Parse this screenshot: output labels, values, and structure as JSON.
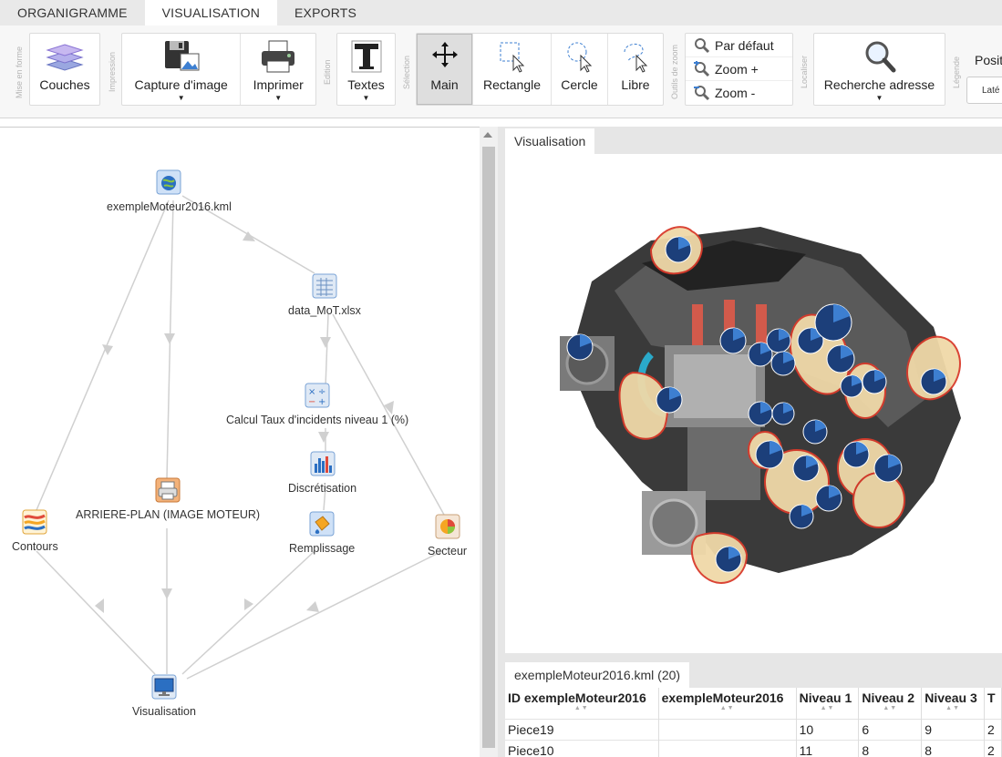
{
  "tabs": [
    {
      "label": "ORGANIGRAMME",
      "active": false
    },
    {
      "label": "VISUALISATION",
      "active": true
    },
    {
      "label": "EXPORTS",
      "active": false
    }
  ],
  "ribbon": {
    "groups": {
      "mise_en_forme": "Mise en forme",
      "impression": "Impression",
      "edition": "Edition",
      "selection": "Sélection",
      "outils_zoom": "Outils de zoom",
      "localiser": "Localiser",
      "legende": "Légende"
    },
    "couches": "Couches",
    "capture": "Capture d'image",
    "imprimer": "Imprimer",
    "textes": "Textes",
    "main": "Main",
    "rectangle": "Rectangle",
    "cercle": "Cercle",
    "libre": "Libre",
    "zoom_default": "Par défaut",
    "zoom_plus": "Zoom +",
    "zoom_minus": "Zoom -",
    "recherche": "Recherche adresse",
    "position_label": "Positi",
    "position_value": "Laté"
  },
  "graph": {
    "nodes": {
      "kml": "exempleMoteur2016.kml",
      "data": "data_MoT.xlsx",
      "calc": "Calcul Taux d'incidents niveau 1 (%)",
      "discr": "Discrétisation",
      "rempl": "Remplissage",
      "contours": "Contours",
      "arriere": "ARRIERE-PLAN (IMAGE MOTEUR)",
      "secteur": "Secteur",
      "visu": "Visualisation"
    }
  },
  "visualisation": {
    "tab": "Visualisation"
  },
  "table": {
    "tab": "exempleMoteur2016.kml (20)",
    "columns": [
      "ID exempleMoteur2016",
      "exempleMoteur2016",
      "Niveau 1",
      "Niveau 2",
      "Niveau 3",
      "T"
    ],
    "rows": [
      [
        "Piece19",
        "",
        "10",
        "6",
        "9",
        "2"
      ],
      [
        "Piece10",
        "",
        "11",
        "8",
        "8",
        "2"
      ]
    ]
  },
  "colors": {
    "accent": "#4a90d9",
    "pie_dark": "#1c3f7a",
    "pie_light": "#3d7fd1",
    "part_red": "#d93a2b"
  }
}
